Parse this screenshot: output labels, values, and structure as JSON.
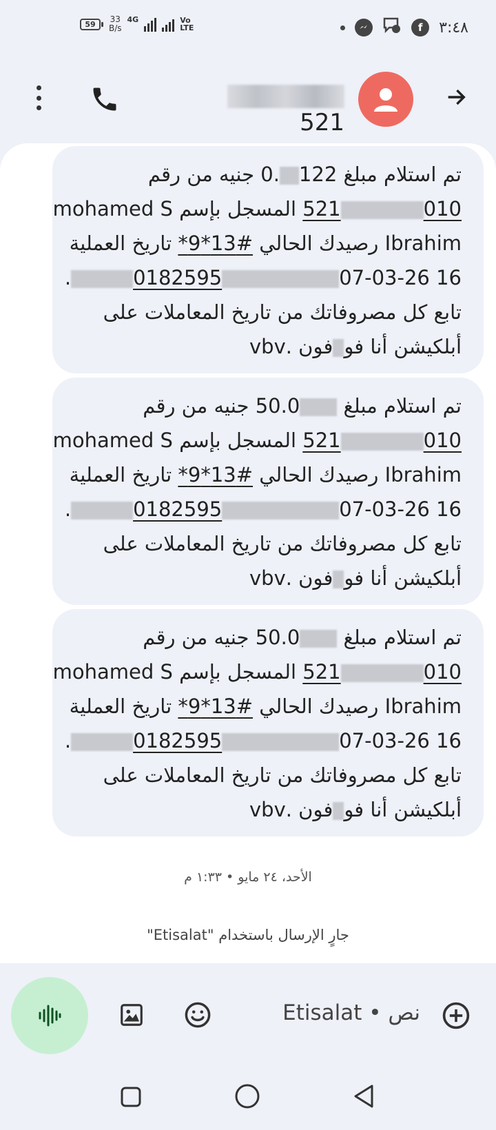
{
  "status_bar": {
    "battery": "59",
    "net_speed_value": "33",
    "net_speed_unit": "B/s",
    "network_gen": "4G",
    "volte_line1": "Vo",
    "volte_line2": "LTE",
    "time": "٣:٤٨",
    "icons": [
      "messenger-icon",
      "chat-bubble-icon",
      "facebook-icon"
    ]
  },
  "header": {
    "contact_number_suffix": "521"
  },
  "messages": [
    {
      "line1": "تم استلام مبلغ 122",
      "line1b": ".0 جنيه من رقم",
      "line2_prefix": "010",
      "line2_suffix": "521",
      "line2_text": " المسجل بإسم mohamed S",
      "line3_a": "Ibrahim رصيدك الحالي ",
      "line3_code": "#13*9*",
      "line3_b": " تاريخ العملية",
      "line4_a": "16 07-03-26",
      "line4_ref": "0182595",
      "line5": "تابع كل مصروفاتك من تاريخ المعاملات على",
      "line6_a": "أبلكيشن أنا فو",
      "line6_b": "فون .vbv"
    },
    {
      "line1": "تم استلام مبلغ ",
      "line1b": "50.0 جنيه من رقم",
      "line2_prefix": "010",
      "line2_suffix": "521",
      "line2_text": " المسجل بإسم mohamed S",
      "line3_a": "Ibrahim رصيدك الحالي ",
      "line3_code": "#13*9*",
      "line3_b": " تاريخ العملية",
      "line4_a": "16 07-03-26",
      "line4_ref": "0182595",
      "line5": "تابع كل مصروفاتك من تاريخ المعاملات على",
      "line6_a": "أبلكيشن أنا فو",
      "line6_b": "فون .vbv"
    },
    {
      "line1": "تم استلام مبلغ ",
      "line1b": "50.0 جنيه من رقم",
      "line2_prefix": "010",
      "line2_suffix": "521",
      "line2_text": " المسجل بإسم mohamed S",
      "line3_a": "Ibrahim رصيدك الحالي ",
      "line3_code": "#13*9*",
      "line3_b": " تاريخ العملية",
      "line4_a": "16 07-03-26",
      "line4_ref": "0182595",
      "line5": "تابع كل مصروفاتك من تاريخ المعاملات على",
      "line6_a": "أبلكيشن أنا فو",
      "line6_b": "فون .vbv"
    }
  ],
  "timestamp": "الأحد، ٢٤ مايو • ١:٣٣ م",
  "sending_via": "جارٍ الإرسال باستخدام \"Etisalat\"",
  "compose": {
    "placeholder": "نص • Etisalat"
  },
  "colors": {
    "avatar": "#ee6a60",
    "voice_button": "#c6efd2",
    "bubble": "#eef1f8"
  }
}
